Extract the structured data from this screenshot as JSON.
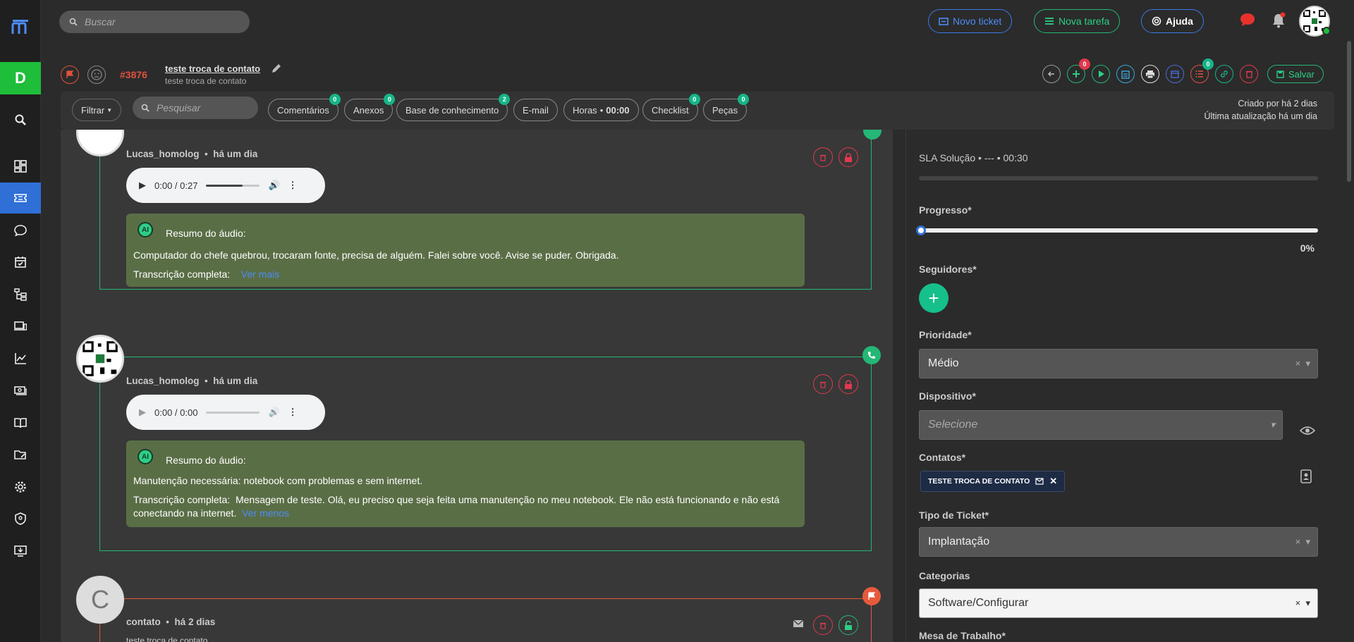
{
  "topbar": {
    "search_placeholder": "Buscar",
    "new_ticket": "Novo ticket",
    "new_task": "Nova tarefa",
    "help": "Ajuda"
  },
  "sidebar": {
    "tenant_letter": "D",
    "items": [
      "search-icon",
      "dashboard-icon",
      "ticket-icon",
      "chat-icon",
      "calendar-check-icon",
      "tree-icon",
      "devices-icon",
      "chart-icon",
      "money-icon",
      "book-icon",
      "folder-edit-icon",
      "gear-icon",
      "shield-icon",
      "download-monitor-icon"
    ]
  },
  "ticket": {
    "id": "#3876",
    "title": "teste troca de contato",
    "subtitle": "teste troca de contato",
    "save": "Salvar",
    "action_badges": {
      "add": "0",
      "tasks": "0"
    }
  },
  "filterbar": {
    "filter": "Filtrar",
    "search_placeholder": "Pesquisar",
    "tabs": [
      {
        "label": "Comentários",
        "badge": "0"
      },
      {
        "label": "Anexos",
        "badge": "0"
      },
      {
        "label": "Base de conhecimento",
        "badge": "2"
      },
      {
        "label": "E-mail",
        "badge": ""
      },
      {
        "label": "Horas",
        "value": "00:00",
        "badge": ""
      },
      {
        "label": "Checklist",
        "badge": "0"
      },
      {
        "label": "Peças",
        "badge": "0"
      }
    ],
    "created": "Criado por há 2 dias",
    "updated": "Última atualização há um dia"
  },
  "feed": {
    "items": [
      {
        "author": "Lucas_homolog",
        "time": "há um dia",
        "audio_time": "0:00 / 0:27",
        "summary_title": "Resumo do áudio:",
        "summary": "Computador do chefe quebrou, trocaram fonte, precisa de alguém. Falei sobre você. Avise se puder. Obrigada.",
        "transcription_label": "Transcrição completa:",
        "transcription": "",
        "link": "Ver mais"
      },
      {
        "author": "Lucas_homolog",
        "time": "há um dia",
        "audio_time": "0:00 / 0:00",
        "summary_title": "Resumo do áudio:",
        "summary": "Manutenção necessária: notebook com problemas e sem internet.",
        "transcription_label": "Transcrição completa:",
        "transcription": "Mensagem de teste. Olá, eu preciso que seja feita uma manutenção no meu notebook. Ele não está funcionando e não está conectando na internet.",
        "link": "Ver menos"
      },
      {
        "author": "contato",
        "time": "há 2 dias",
        "avatar_letter": "C",
        "subtitle": "teste troca de contato"
      }
    ],
    "ai_badge": "AI"
  },
  "panel": {
    "sla": "SLA Solução • --- • 00:30",
    "progress_label": "Progresso*",
    "progress_value": 0,
    "progress_text": "0%",
    "followers_label": "Seguidores*",
    "priority_label": "Prioridade*",
    "priority_value": "Médio",
    "device_label": "Dispositivo*",
    "device_placeholder": "Selecione",
    "contacts_label": "Contatos*",
    "contact_chip": "TESTE TROCA DE CONTATO",
    "ticket_type_label": "Tipo de Ticket*",
    "ticket_type_value": "Implantação",
    "categories_label": "Categorias",
    "categories_value": "Software/Configurar",
    "workdesk_label": "Mesa de Trabalho*"
  },
  "colors": {
    "accent_blue": "#2f6fd6",
    "accent_green": "#24b776",
    "danger": "#e0394d",
    "tenant_green": "#1ebd3a",
    "summary_bg": "#5a6e46"
  }
}
